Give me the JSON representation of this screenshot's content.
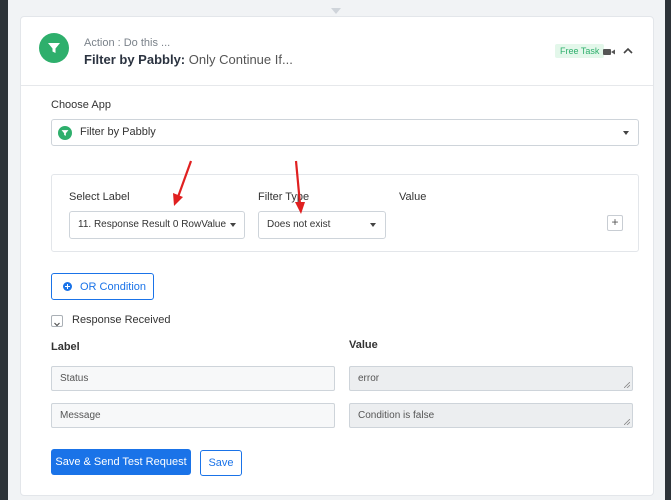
{
  "step": {
    "action_label": "Action : Do this ...",
    "app_name": "Filter by Pabbly:",
    "subtitle": "Only Continue If...",
    "badge": "Free Task",
    "icons": {
      "app": "filter-funnel-icon",
      "video": "video-camera-icon",
      "collapse": "chevron-up-icon"
    }
  },
  "choose_app": {
    "label": "Choose App",
    "selected": "Filter by Pabbly"
  },
  "filter": {
    "select_label_header": "Select Label",
    "filter_type_header": "Filter Type",
    "value_header": "Value",
    "select_label_value": "11. Response Result 0 RowValue",
    "filter_type_value": "Does not exist",
    "add_label": "+"
  },
  "or_condition": {
    "label": "OR Condition"
  },
  "response": {
    "title": "Response Received",
    "label_header": "Label",
    "value_header": "Value",
    "rows": [
      {
        "label": "Status",
        "value": "error"
      },
      {
        "label": "Message",
        "value": "Condition is false"
      }
    ]
  },
  "actions": {
    "save_send": "Save & Send Test Request",
    "save": "Save"
  },
  "colors": {
    "accent": "#1a73e8",
    "brand_green": "#2eaf6c",
    "annotation": "#e02020"
  }
}
